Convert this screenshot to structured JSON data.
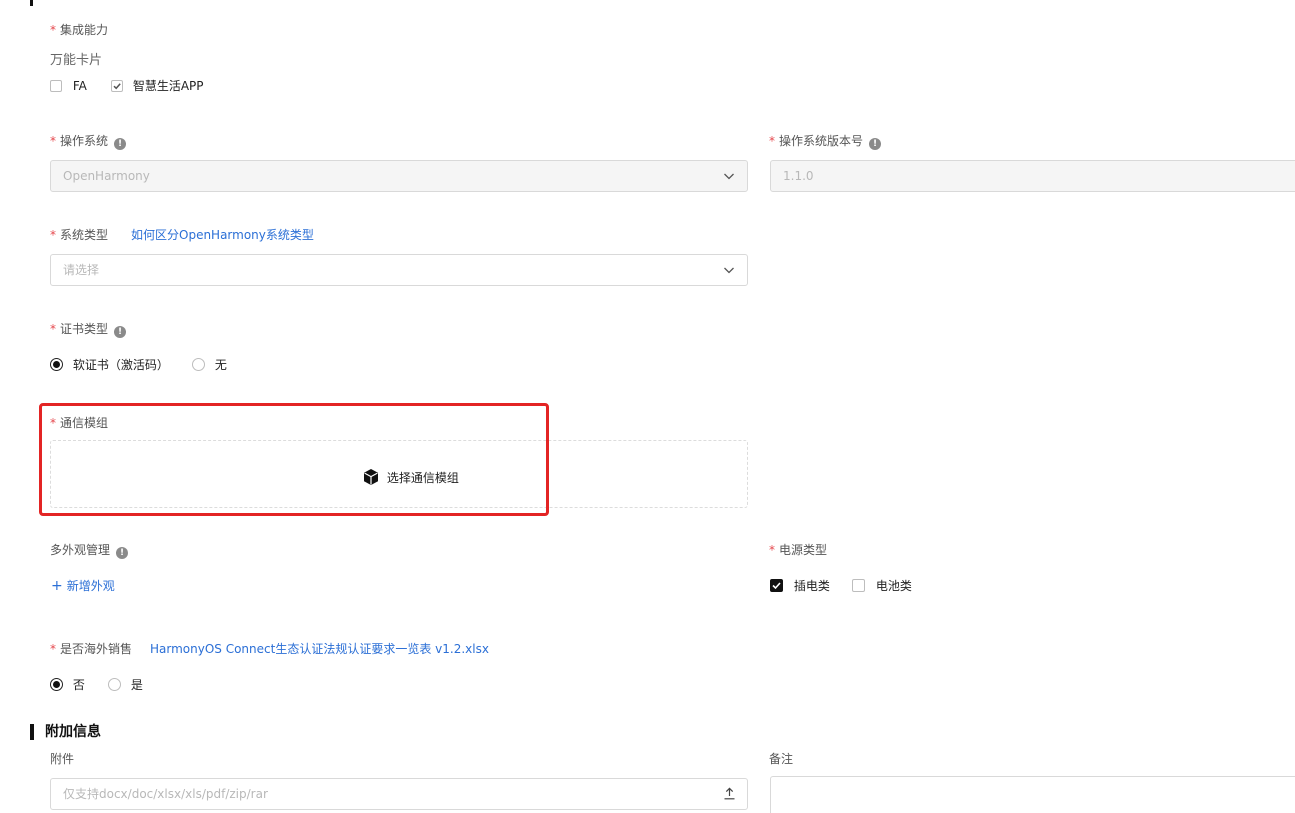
{
  "integration": {
    "label": "集成能力",
    "sub_label": "万能卡片",
    "options": [
      {
        "label": "FA",
        "checked": false
      },
      {
        "label": "智慧生活APP",
        "checked": true
      }
    ]
  },
  "os": {
    "label": "操作系统",
    "value": "OpenHarmony"
  },
  "os_version": {
    "label": "操作系统版本号",
    "value": "1.1.0"
  },
  "system_type": {
    "label": "系统类型",
    "help_link": "如何区分OpenHarmony系统类型",
    "placeholder": "请选择"
  },
  "cert_type": {
    "label": "证书类型",
    "options": [
      {
        "label": "软证书（激活码）",
        "selected": true
      },
      {
        "label": "无",
        "selected": false
      }
    ]
  },
  "comm_module": {
    "label": "通信模组",
    "button_label": "选择通信模组"
  },
  "appearance": {
    "label": "多外观管理",
    "add_label": "新增外观"
  },
  "power_type": {
    "label": "电源类型",
    "options": [
      {
        "label": "插电类",
        "checked": true
      },
      {
        "label": "电池类",
        "checked": false
      }
    ]
  },
  "overseas": {
    "label": "是否海外销售",
    "doc_link": "HarmonyOS Connect生态认证法规认证要求一览表 v1.2.xlsx",
    "options": [
      {
        "label": "否",
        "selected": true
      },
      {
        "label": "是",
        "selected": false
      }
    ]
  },
  "extra": {
    "title": "附加信息",
    "attachment_label": "附件",
    "attachment_placeholder": "仅支持docx/doc/xlsx/xls/pdf/zip/rar",
    "remark_label": "备注"
  },
  "icons": {
    "info": "info-icon",
    "chevron": "chevron-down-icon",
    "cube": "cube-icon",
    "upload": "upload-icon",
    "plus": "plus-icon"
  },
  "colors": {
    "required": "#e5484d",
    "link": "#2b6fd6",
    "highlight_frame": "#e32424"
  }
}
